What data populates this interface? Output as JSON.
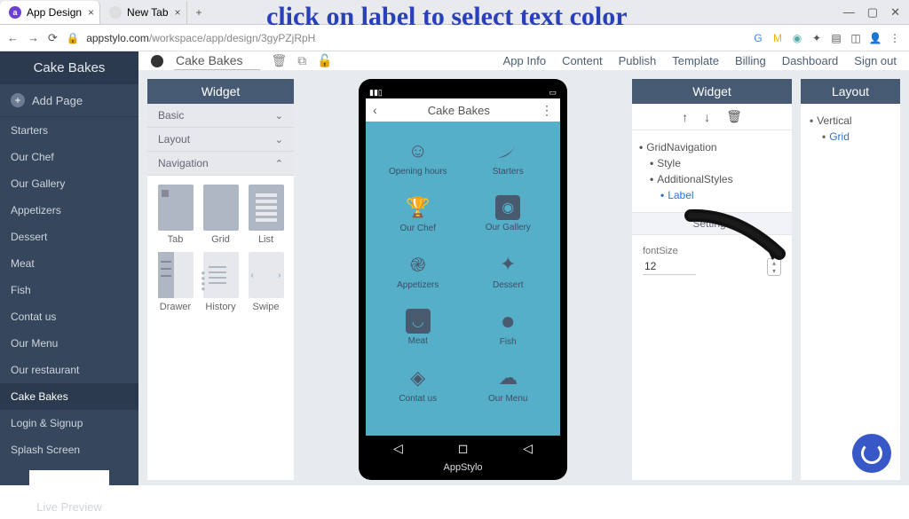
{
  "annotation": "click on label to select text color",
  "browser": {
    "tabs": [
      {
        "title": "App Design",
        "fav": "a"
      },
      {
        "title": "New Tab",
        "fav": ""
      }
    ],
    "url_host": "appstylo.com",
    "url_path": "/workspace/app/design/3gyPZjRpH"
  },
  "top_bar": {
    "page_name": "Cake Bakes",
    "menu": [
      "App Info",
      "Content",
      "Publish",
      "Template",
      "Billing",
      "Dashboard",
      "Sign out"
    ]
  },
  "left_panel": {
    "title": "Cake Bakes",
    "add_page": "Add Page",
    "items": [
      "Starters",
      "Our Chef",
      "Our Gallery",
      "Appetizers",
      "Dessert",
      "Meat",
      "Fish",
      "Contat us",
      "Our Menu",
      "Our restaurant",
      "Cake Bakes",
      "Login & Signup",
      "Splash Screen"
    ],
    "active_index": 10,
    "live_preview": "Live Preview"
  },
  "widget_left": {
    "title": "Widget",
    "sections": [
      {
        "label": "Basic",
        "open": false
      },
      {
        "label": "Layout",
        "open": false
      },
      {
        "label": "Navigation",
        "open": true
      }
    ],
    "nav_items": [
      "Tab",
      "Grid",
      "List",
      "Drawer",
      "History",
      "Swipe"
    ]
  },
  "phone": {
    "header": "Cake Bakes",
    "brand": "AppStylo",
    "grid": [
      {
        "label": "Opening hours",
        "icon": "☺"
      },
      {
        "label": "Starters",
        "icon": "leaf"
      },
      {
        "label": "Our Chef",
        "icon": "🏆"
      },
      {
        "label": "Our Gallery",
        "icon": "📷"
      },
      {
        "label": "Appetizers",
        "icon": "spiral"
      },
      {
        "label": "Dessert",
        "icon": "✦"
      },
      {
        "label": "Meat",
        "icon": "cup"
      },
      {
        "label": "Fish",
        "icon": "●"
      },
      {
        "label": "Contat us",
        "icon": "◇"
      },
      {
        "label": "Our Menu",
        "icon": "cloud"
      }
    ]
  },
  "widget_right": {
    "title": "Widget",
    "tree": {
      "root": "GridNavigation",
      "child1": "Style",
      "child2": "AdditionalStyles",
      "leaf": "Label"
    },
    "settings_title": "Settings",
    "setting": {
      "label": "fontSize",
      "value": "12"
    }
  },
  "layout_panel": {
    "title": "Layout",
    "items": [
      "Vertical",
      "Grid"
    ]
  }
}
